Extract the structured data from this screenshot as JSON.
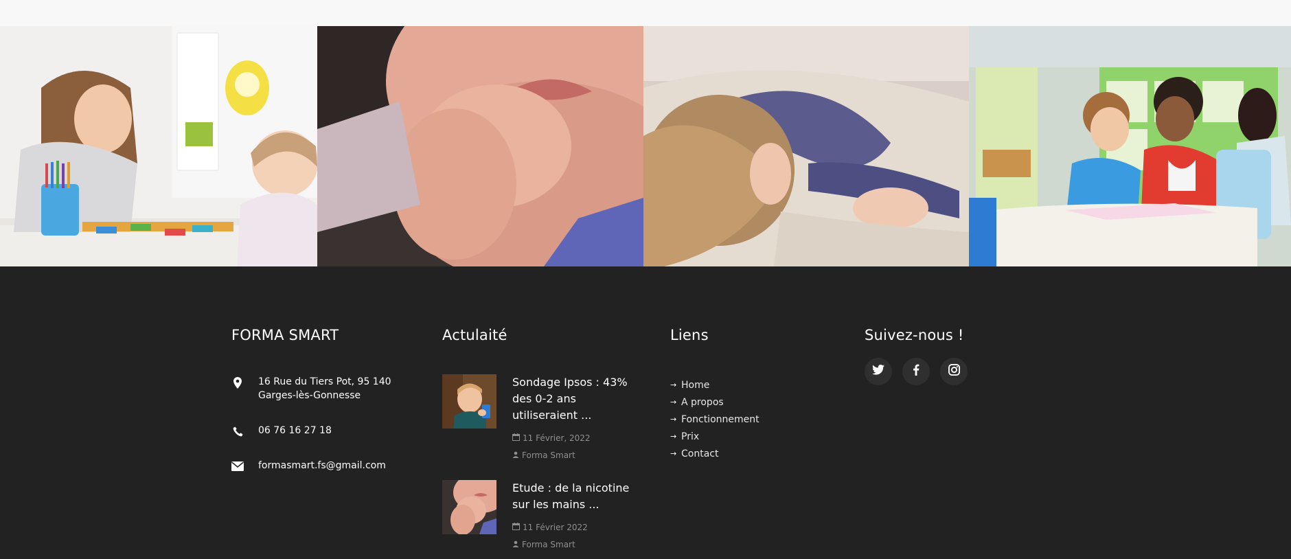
{
  "gallery": {
    "images": [
      {
        "icon": "photo-teacher-and-toddler"
      },
      {
        "icon": "photo-baby-sucking-fingers"
      },
      {
        "icon": "photo-child-sleeping"
      },
      {
        "icon": "photo-kids-reading-classroom"
      }
    ]
  },
  "footer": {
    "brand": {
      "title": "FORMA SMART",
      "address_line1": "16 Rue du Tiers Pot, 95 140",
      "address_line2": "Garges-lès-Gonnesse",
      "phone": "06 76 16 27 18",
      "email": "formasmart.fs@gmail.com"
    },
    "news": {
      "title": "Actulaité",
      "items": [
        {
          "title": "Sondage Ipsos : 43% des 0-2 ans utiliseraient ...",
          "date": "11 Février, 2022",
          "author": "Forma Smart"
        },
        {
          "title": "Etude : de la nicotine sur les mains ...",
          "date": "11 Février 2022",
          "author": "Forma Smart"
        }
      ]
    },
    "links": {
      "title": "Liens",
      "items": [
        {
          "label": "Home"
        },
        {
          "label": "A propos"
        },
        {
          "label": "Fonctionnement"
        },
        {
          "label": "Prix"
        },
        {
          "label": "Contact"
        }
      ]
    },
    "social": {
      "title": "Suivez-nous !",
      "items": [
        {
          "icon": "twitter-icon"
        },
        {
          "icon": "facebook-icon"
        },
        {
          "icon": "instagram-icon"
        }
      ]
    }
  },
  "colors": {
    "footer_bg": "#222222",
    "social_bg": "#2f2f2f",
    "meta_text": "#8f8f8f"
  }
}
